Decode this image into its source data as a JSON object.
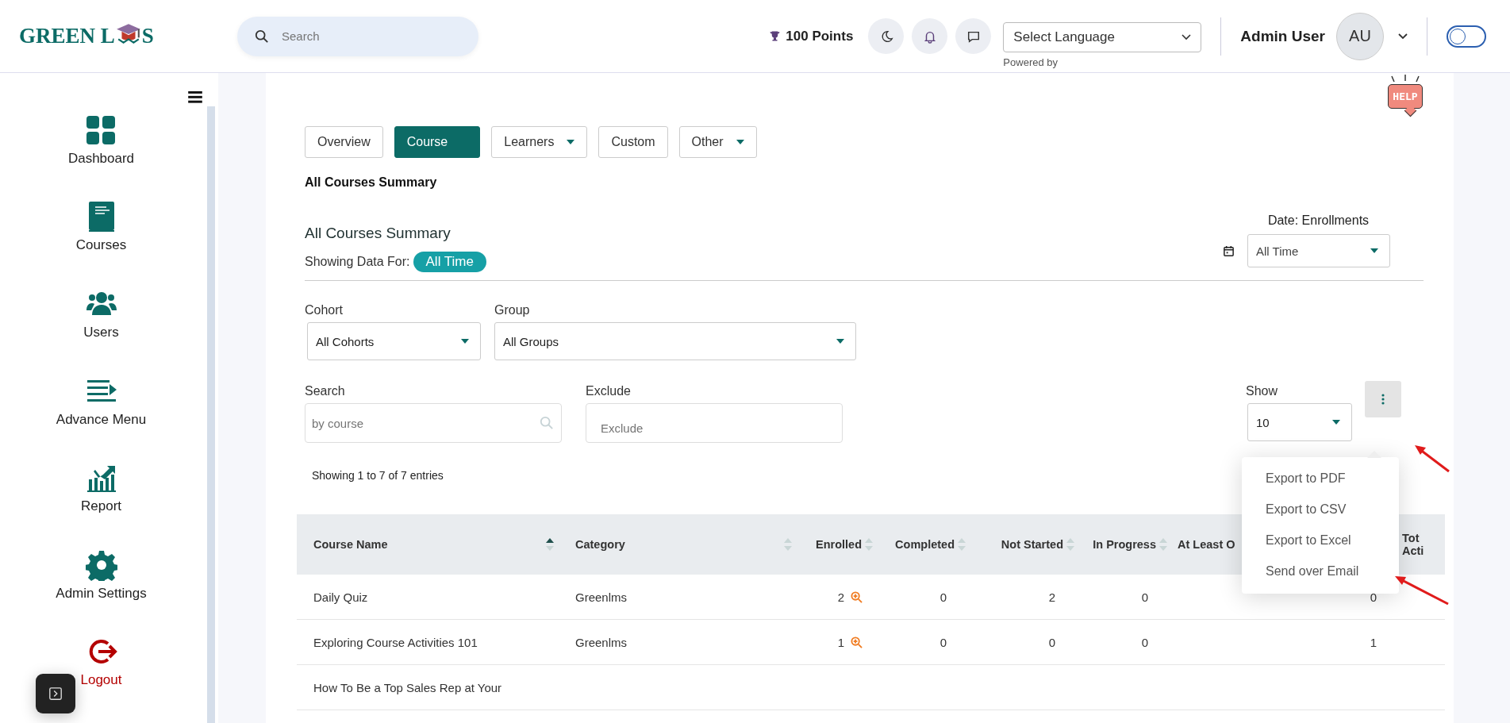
{
  "header": {
    "logo": {
      "before": "GREEN L",
      "after": "S"
    },
    "search": {
      "placeholder": "Search"
    },
    "points": "100 Points",
    "language": {
      "value": "Select Language",
      "note": "Powered by"
    },
    "user": {
      "name": "Admin User",
      "initials": "AU"
    },
    "toggle": {
      "on": false
    }
  },
  "sidebar": {
    "items": [
      {
        "label": "Dashboard",
        "kind": "normal"
      },
      {
        "label": "Courses",
        "kind": "normal"
      },
      {
        "label": "Users",
        "kind": "normal"
      },
      {
        "label": "Advance Menu",
        "kind": "normal"
      },
      {
        "label": "Report",
        "kind": "normal"
      },
      {
        "label": "Admin Settings",
        "kind": "normal"
      },
      {
        "label": "Logout",
        "kind": "danger"
      }
    ]
  },
  "help": "HELP",
  "tabs": [
    {
      "label": "Overview",
      "selected": false,
      "dropdown": false
    },
    {
      "label": "Course",
      "selected": true,
      "dropdown": false
    },
    {
      "label": "Learners",
      "selected": false,
      "dropdown": true
    },
    {
      "label": "Custom",
      "selected": false,
      "dropdown": false
    },
    {
      "label": "Other",
      "selected": false,
      "dropdown": true
    }
  ],
  "breadcrumb": "All Courses Summary",
  "summary": {
    "title": "All Courses Summary",
    "showing_label": "Showing Data For:",
    "period_badge": "All Time",
    "date_label": "Date: Enrollments",
    "date_select": "All Time"
  },
  "filters": [
    {
      "label": "Cohort",
      "value": "All Cohorts"
    },
    {
      "label": "Group",
      "value": "All Groups"
    }
  ],
  "search": {
    "label": "Search",
    "placeholder": "by course"
  },
  "exclude": {
    "label": "Exclude",
    "placeholder": "Exclude"
  },
  "show": {
    "label": "Show",
    "value": "10"
  },
  "export_menu": {
    "expanded": true,
    "items": [
      "Export to PDF",
      "Export to CSV",
      "Export to Excel",
      "Send over Email"
    ]
  },
  "entries": "Showing 1 to 7 of 7 entries",
  "table": {
    "columns": [
      {
        "label": "Course Name",
        "sorted": true,
        "kind": "text"
      },
      {
        "label": "Category",
        "sorted": false,
        "kind": "text"
      },
      {
        "label": "Enrolled",
        "sorted": false,
        "kind": "zoom"
      },
      {
        "label": "Completed",
        "sorted": false,
        "kind": "number"
      },
      {
        "label": "Not Started",
        "sorted": false,
        "kind": "number"
      },
      {
        "label": "In Progress",
        "sorted": false,
        "kind": "number"
      },
      {
        "label": "At Least O",
        "kind": "text"
      },
      {
        "label": "Tot Acti",
        "kind": "number"
      }
    ],
    "rows": [
      [
        "Daily Quiz",
        "Greenlms",
        "2",
        "0",
        "2",
        "0",
        null,
        "0"
      ],
      [
        "Exploring Course Activities 101",
        "Greenlms",
        "1",
        "0",
        "0",
        "0",
        null,
        "1"
      ],
      [
        "How To Be a Top Sales Rep at Your",
        null,
        null,
        null,
        null,
        null,
        null,
        null
      ]
    ]
  }
}
